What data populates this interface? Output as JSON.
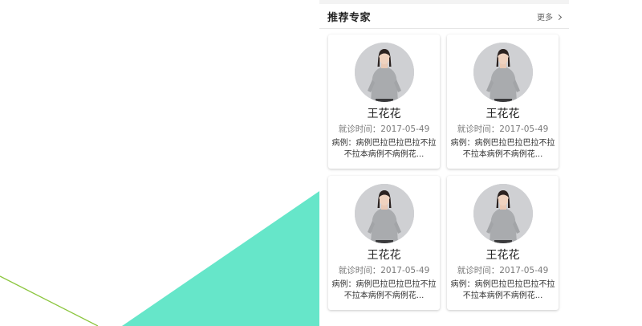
{
  "panel": {
    "title": "推荐专家",
    "more_label": "更多"
  },
  "experts": [
    {
      "name": "王花花",
      "visit_time": "就诊时间：2017-05-49",
      "case_line1": "病例：病例巴拉巴拉巴拉不拉",
      "case_line2": "不拉本病例不病例花..."
    },
    {
      "name": "王花花",
      "visit_time": "就诊时间：2017-05-49",
      "case_line1": "病例：病例巴拉巴拉巴拉不拉",
      "case_line2": "不拉本病例不病例花..."
    },
    {
      "name": "王花花",
      "visit_time": "就诊时间：2017-05-49",
      "case_line1": "病例：病例巴拉巴拉巴拉不拉",
      "case_line2": "不拉本病例不病例花..."
    },
    {
      "name": "王花花",
      "visit_time": "就诊时间：2017-05-49",
      "case_line1": "病例：病例巴拉巴拉巴拉不拉",
      "case_line2": "不拉本病例不病例花..."
    }
  ],
  "icons": {
    "more": "chevron-right-icon",
    "avatar": "person-photo"
  },
  "colors": {
    "accent_teal": "#66e6c9",
    "accent_line": "#8cc63f"
  }
}
